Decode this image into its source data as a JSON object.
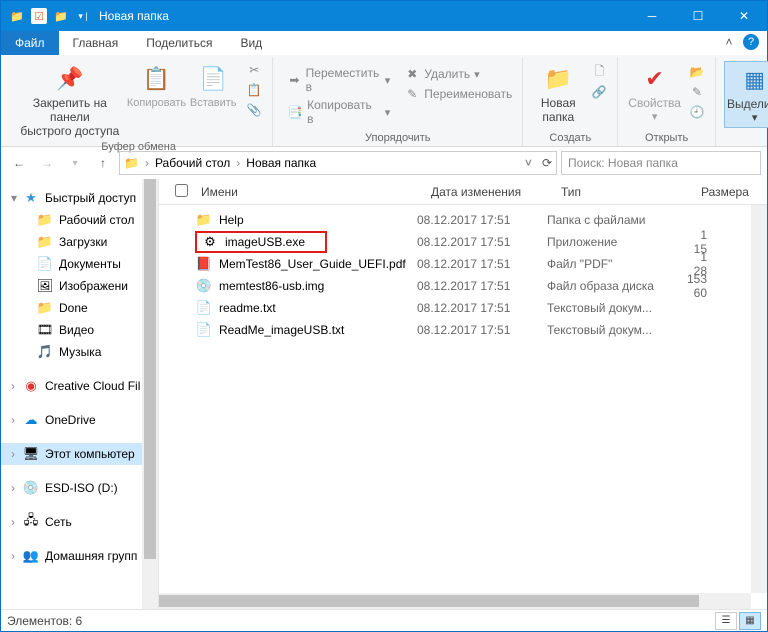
{
  "title": "Новая папка",
  "tabs": {
    "file": "Файл",
    "home": "Главная",
    "share": "Поделиться",
    "view": "Вид"
  },
  "ribbon": {
    "pin_line1": "Закрепить на панели",
    "pin_line2": "быстрого доступа",
    "copy": "Копировать",
    "paste": "Вставить",
    "clipboard_group": "Буфер обмена",
    "moveto": "Переместить в",
    "copyto": "Копировать в",
    "delete": "Удалить",
    "rename": "Переименовать",
    "organize_group": "Упорядочить",
    "newfolder": "Новая",
    "newfolder2": "папка",
    "create_group": "Создать",
    "properties": "Свойства",
    "open_group": "Открыть",
    "select": "Выделить"
  },
  "breadcrumb": {
    "p1": "Рабочий стол",
    "p2": "Новая папка"
  },
  "search_placeholder": "Поиск: Новая папка",
  "columns": {
    "name": "Имени",
    "date": "Дата изменения",
    "type": "Тип",
    "size": "Размера"
  },
  "sidebar": {
    "quick": "Быстрый доступ",
    "desktop": "Рабочий стол",
    "downloads": "Загрузки",
    "documents": "Документы",
    "pictures": "Изображени",
    "done": "Done",
    "videos": "Видео",
    "music": "Музыка",
    "cc": "Creative Cloud Fil",
    "onedrive": "OneDrive",
    "thispc": "Этот компьютер",
    "esd": "ESD-ISO (D:)",
    "network": "Сеть",
    "homegroup": "Домашняя групп"
  },
  "files": [
    {
      "icon": "folder",
      "name": "Help",
      "date": "08.12.2017 17:51",
      "type": "Папка с файлами",
      "size": ""
    },
    {
      "icon": "exe",
      "name": "imageUSB.exe",
      "date": "08.12.2017 17:51",
      "type": "Приложение",
      "size": "1 15",
      "hl": true
    },
    {
      "icon": "pdf",
      "name": "MemTest86_User_Guide_UEFI.pdf",
      "date": "08.12.2017 17:51",
      "type": "Файл \"PDF\"",
      "size": "1 28"
    },
    {
      "icon": "img",
      "name": "memtest86-usb.img",
      "date": "08.12.2017 17:51",
      "type": "Файл образа диска",
      "size": "153 60"
    },
    {
      "icon": "txt",
      "name": "readme.txt",
      "date": "08.12.2017 17:51",
      "type": "Текстовый докум...",
      "size": ""
    },
    {
      "icon": "txt",
      "name": "ReadMe_imageUSB.txt",
      "date": "08.12.2017 17:51",
      "type": "Текстовый докум...",
      "size": ""
    }
  ],
  "status": "Элементов: 6"
}
